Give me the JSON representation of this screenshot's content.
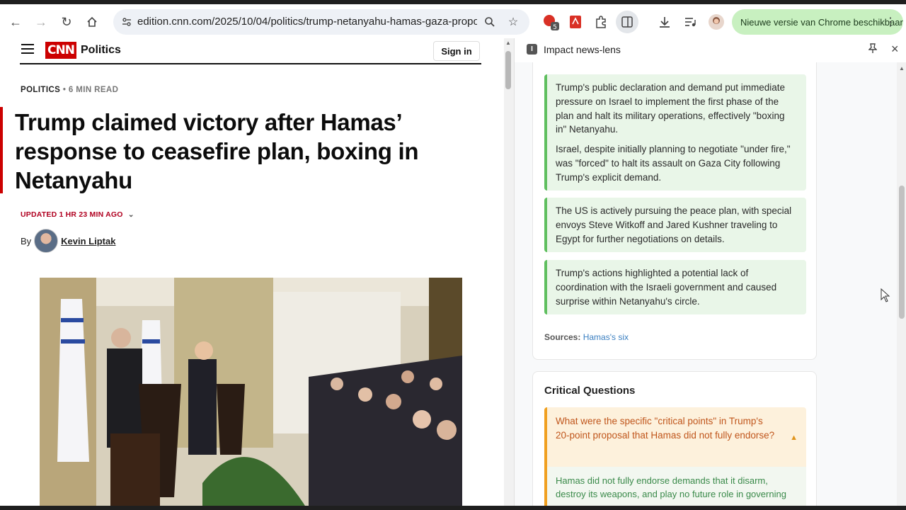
{
  "browser": {
    "url": "edition.cnn.com/2025/10/04/politics/trump-netanyahu-hamas-gaza-propo...",
    "extension_badge": "5",
    "update_message": "Nieuwe versie van Chrome beschikbaar"
  },
  "article": {
    "logo": "CNN",
    "section": "Politics",
    "signin": "Sign in",
    "kicker": "POLITICS",
    "read_time": " • 6 MIN READ",
    "headline": "Trump claimed victory after Hamas’ response to ceasefire plan, boxing in Netanyahu",
    "updated": "UPDATED 1 HR 23 MIN AGO",
    "by": "By",
    "author": "Kevin Liptak"
  },
  "panel": {
    "title": "Impact news-lens",
    "facts": [
      "Trump's public declaration and demand put immediate pressure on Israel to implement the first phase of the plan and halt its military operations, effectively \"boxing in\" Netanyahu.",
      "Israel, despite initially planning to negotiate \"under fire,\" was \"forced\" to halt its assault on Gaza City following Trump's explicit demand.",
      "The US is actively pursuing the peace plan, with special envoys Steve Witkoff and Jared Kushner traveling to Egypt for further negotiations on details.",
      "Trump's actions highlighted a potential lack of coordination with the Israeli government and caused surprise within Netanyahu's circle."
    ],
    "sources_label": "Sources:",
    "sources_link": "Hamas's six",
    "critical_title": "Critical Questions",
    "question": "What were the specific \"critical points\" in Trump's 20-point proposal that Hamas did not fully endorse?",
    "answer": "Hamas did not fully endorse demands that it disarm, destroy its weapons, and play no future role in governing"
  }
}
